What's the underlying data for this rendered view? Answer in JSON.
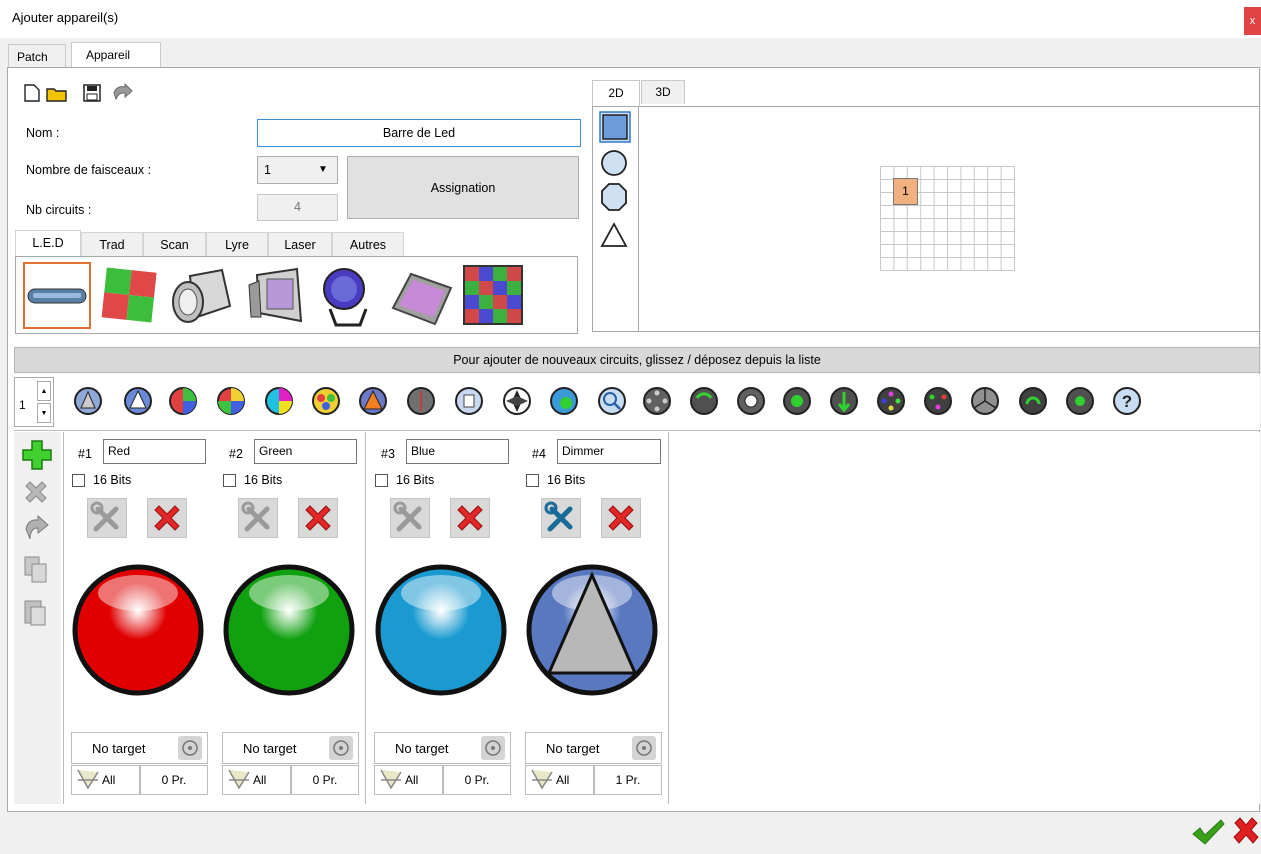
{
  "window": {
    "title": "Ajouter appareil(s)",
    "close_label": "x"
  },
  "main_tabs": [
    "Patch",
    "Appareil"
  ],
  "form": {
    "nom_label": "Nom :",
    "nom_value": "Barre de Led",
    "faisceaux_label": "Nombre de faisceaux :",
    "faisceaux_value": "1",
    "circuits_label": "Nb circuits :",
    "circuits_value": "4",
    "assign_label": "Assignation"
  },
  "type_tabs": [
    "L.E.D",
    "Trad",
    "Scan",
    "Lyre",
    "Laser",
    "Autres"
  ],
  "view_tabs": [
    "2D",
    "3D"
  ],
  "grid_cell_label": "1",
  "info_bar": "Pour ajouter de nouveaux circuits, glissez / déposez depuis la liste",
  "spinner_value": "1",
  "circuits": [
    {
      "num": "#1",
      "name": "Red",
      "bits": "16 Bits",
      "target": "No target",
      "all": "All",
      "pr": "0 Pr.",
      "color": "#e00000"
    },
    {
      "num": "#2",
      "name": "Green",
      "bits": "16 Bits",
      "target": "No target",
      "all": "All",
      "pr": "0 Pr.",
      "color": "#10a010"
    },
    {
      "num": "#3",
      "name": "Blue",
      "bits": "16 Bits",
      "target": "No target",
      "all": "All",
      "pr": "0 Pr.",
      "color": "#1a9ad0"
    },
    {
      "num": "#4",
      "name": "Dimmer",
      "bits": "16 Bits",
      "target": "No target",
      "all": "All",
      "pr": "1 Pr.",
      "color": "#5a78c0"
    }
  ],
  "colors": {
    "accent_orange": "#f0b080",
    "selected_border": "#e07030",
    "ok_green": "#3aa01a",
    "cancel_red": "#e02020"
  }
}
